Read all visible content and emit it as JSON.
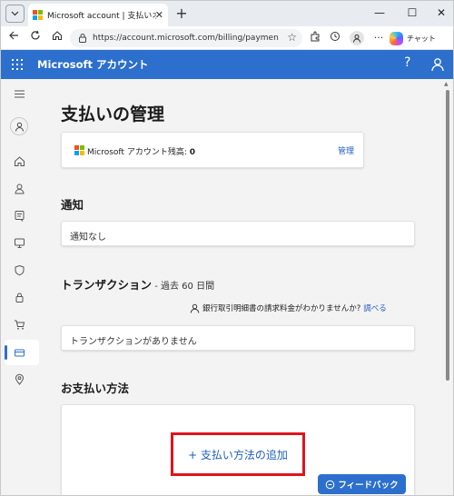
{
  "browser": {
    "tab_title": "Microsoft account | 支払いオプション",
    "tab_close": "✕",
    "new_tab": "+",
    "url": "https://account.microsoft.com/billing/payments/?...",
    "chat_label": "チャット",
    "minimize": "—",
    "maximize": "☐",
    "close": "✕"
  },
  "appbar": {
    "title": "Microsoft アカウント",
    "help": "?"
  },
  "page": {
    "title": "支払いの管理",
    "balance_label": "Microsoft アカウント残高: ",
    "balance_value": "0",
    "manage_link": "管理",
    "notifications_heading": "通知",
    "notifications_empty": "通知なし",
    "transactions_heading": "トランザクション",
    "transactions_sub": " - 過去 60 日間",
    "bank_question": "銀行取引明細書の請求料金がわかりませんか?",
    "bank_link": "調べる",
    "transactions_empty": "トランザクションがありません",
    "payment_heading": "お支払い方法",
    "add_payment": "+ 支払い方法の追加",
    "feedback": "フィードバック"
  },
  "colors": {
    "accent_blue": "#2d6fcd",
    "link_blue": "#1f5fbf",
    "highlight_red": "#e0141e",
    "ms_red": "#f25022",
    "ms_green": "#7fba00",
    "ms_blue": "#00a4ef",
    "ms_yellow": "#ffb900"
  },
  "icons": [
    "tab-actions-icon",
    "microsoft-logo-icon",
    "back-icon",
    "refresh-icon",
    "home-icon",
    "lock-icon",
    "star-icon",
    "extensions-icon",
    "history-icon",
    "profile-icon",
    "more-icon",
    "copilot-icon",
    "waffle-icon",
    "help-icon",
    "account-icon",
    "menu-icon",
    "card-icon",
    "shield-icon",
    "location-icon",
    "cart-icon",
    "device-icon",
    "feedback-icon"
  ]
}
